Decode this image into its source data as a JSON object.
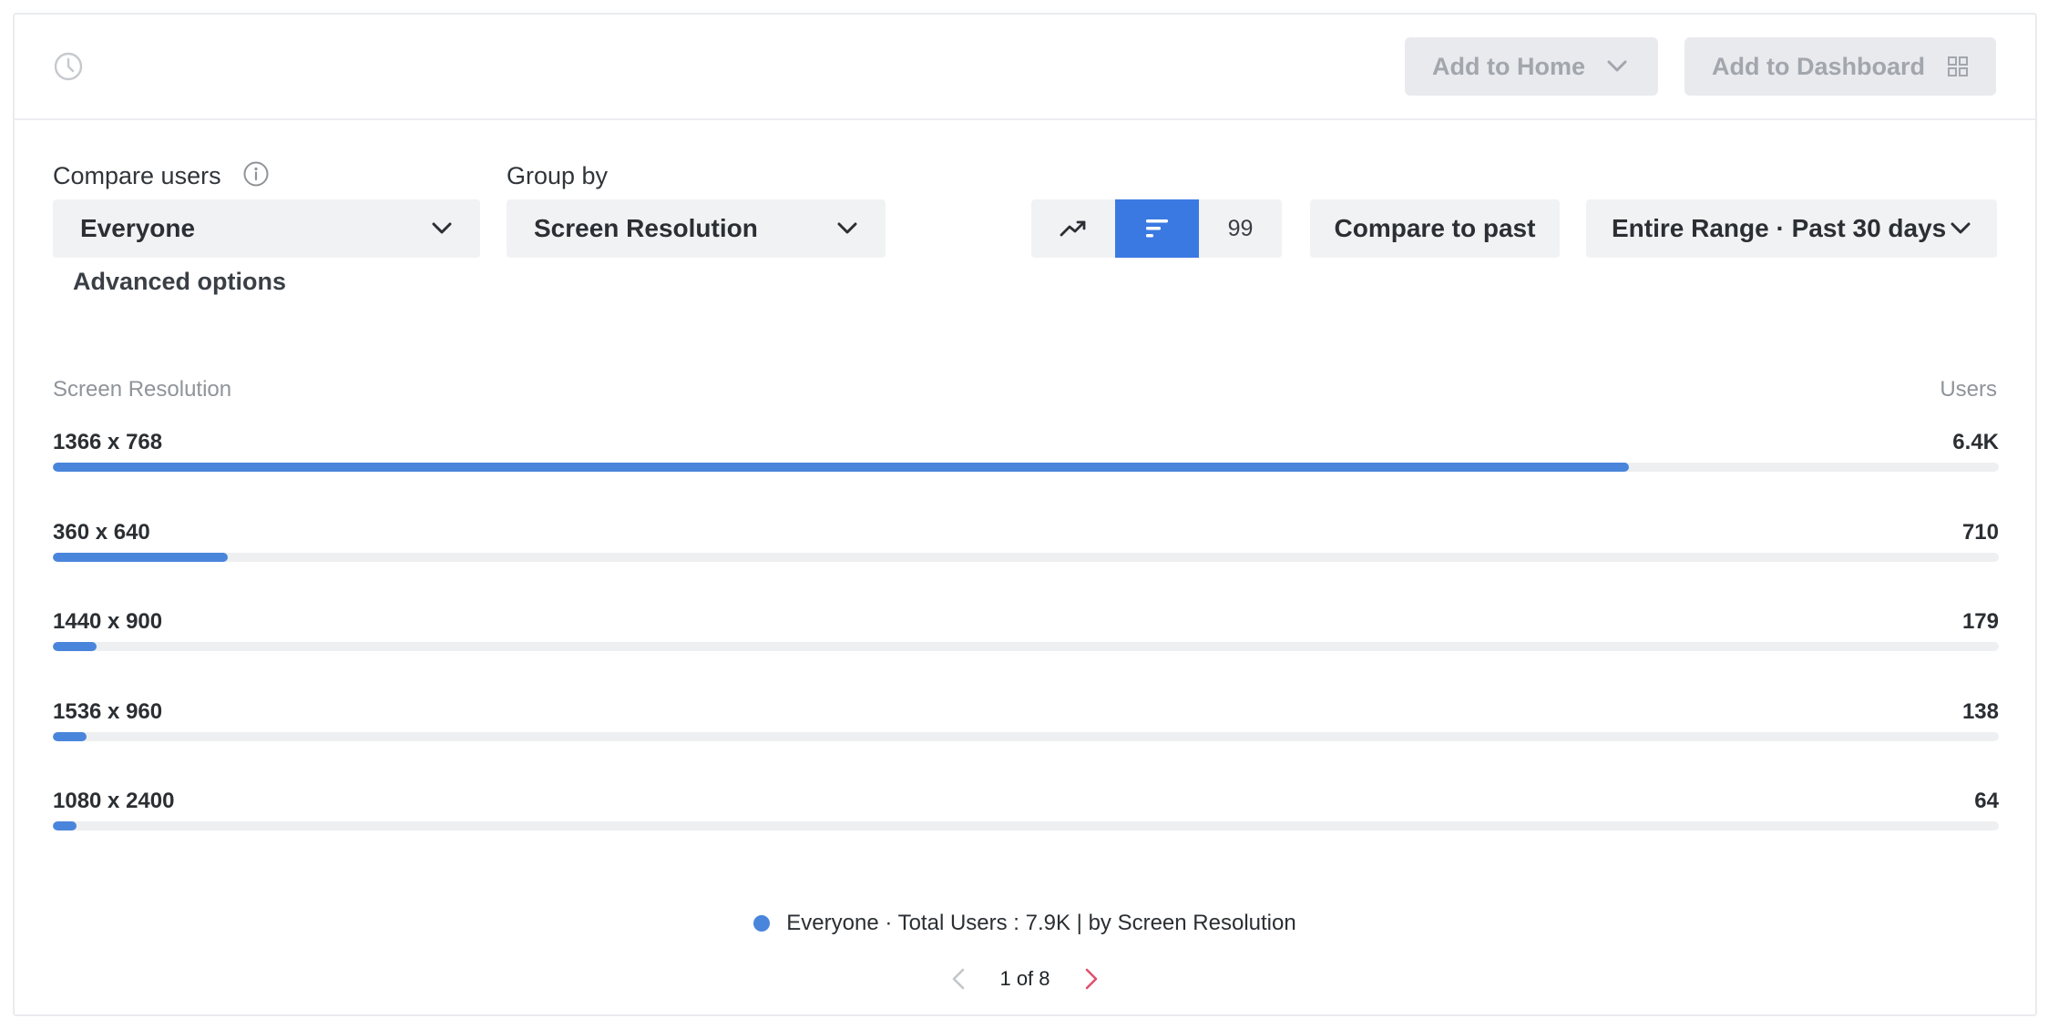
{
  "toolbar": {
    "add_to_home_label": "Add to Home",
    "add_to_dashboard_label": "Add to Dashboard"
  },
  "controls": {
    "compare_users_label": "Compare users",
    "compare_users_value": "Everyone",
    "group_by_label": "Group by",
    "group_by_value": "Screen Resolution",
    "advanced_options_label": "Advanced options",
    "row_limit_value": "99",
    "compare_to_past_label": "Compare to past",
    "date_range_value": "Entire Range · Past 30 days",
    "selected_view": "bar"
  },
  "table": {
    "left_header": "Screen Resolution",
    "right_header": "Users"
  },
  "chart_data": {
    "type": "bar",
    "orientation": "horizontal",
    "categories": [
      "1366 x 768",
      "360 x 640",
      "1440 x 900",
      "1536 x 960",
      "1080 x 2400"
    ],
    "values": [
      6400,
      710,
      179,
      138,
      64
    ],
    "value_labels": [
      "6.4K",
      "710",
      "179",
      "138",
      "64"
    ],
    "xlabel": "Users",
    "ylabel": "Screen Resolution",
    "xlim": [
      0,
      7900
    ],
    "series": [
      {
        "name": "Everyone",
        "color": "#4a85dc"
      }
    ]
  },
  "legend": {
    "text": "Everyone · Total Users : 7.9K | by Screen Resolution",
    "dot_color": "#4a85dc"
  },
  "pagination": {
    "text": "1 of 8",
    "prev_color": "#c3c6ca",
    "next_color": "#e0506e"
  },
  "colors": {
    "accent": "#3a79e2",
    "bar": "#4a85dc"
  }
}
